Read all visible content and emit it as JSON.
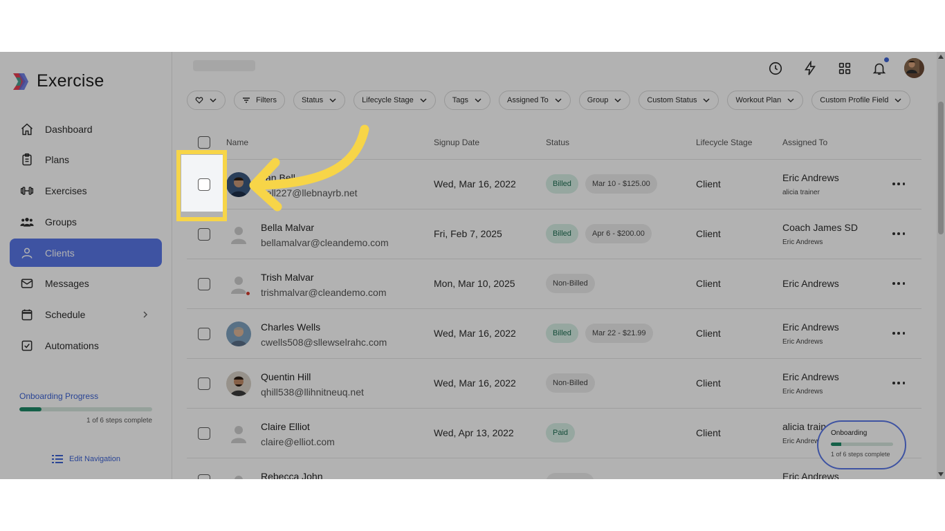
{
  "app": {
    "name": "Exercise"
  },
  "sidebar": {
    "items": [
      {
        "label": "Dashboard",
        "icon": "home-icon"
      },
      {
        "label": "Plans",
        "icon": "clipboard-icon"
      },
      {
        "label": "Exercises",
        "icon": "dumbbell-icon"
      },
      {
        "label": "Groups",
        "icon": "groups-icon"
      },
      {
        "label": "Clients",
        "icon": "user-icon",
        "active": true
      },
      {
        "label": "Messages",
        "icon": "mail-icon"
      },
      {
        "label": "Schedule",
        "icon": "calendar-icon"
      },
      {
        "label": "Automations",
        "icon": "checkbox-icon"
      }
    ],
    "onboarding": {
      "title": "Onboarding Progress",
      "steps_text": "1 of 6 steps complete",
      "progress": 0.167
    },
    "edit_navigation": "Edit Navigation"
  },
  "filters": [
    "Filters",
    "Status",
    "Lifecycle Stage",
    "Tags",
    "Assigned To",
    "Group",
    "Custom Status",
    "Workout Plan",
    "Custom Profile Field"
  ],
  "table": {
    "headers": {
      "name": "Name",
      "signup": "Signup Date",
      "status": "Status",
      "lifecycle": "Lifecycle Stage",
      "assigned": "Assigned To"
    },
    "rows": [
      {
        "name": "Bryan Bell",
        "name_visible": "yan Bell",
        "email_visible": "bell227@llebnayrb.net",
        "date": "Wed, Mar 16, 2022",
        "status": "Billed",
        "amount": "Mar 10 - $125.00",
        "stage": "Client",
        "assigned": "Eric Andrews",
        "assigned2": "alicia trainer"
      },
      {
        "name": "Bella Malvar",
        "email": "bellamalvar@cleandemo.com",
        "date": "Fri, Feb 7, 2025",
        "status": "Billed",
        "amount": "Apr 6 - $200.00",
        "stage": "Client",
        "assigned": "Coach James SD",
        "assigned2": "Eric Andrews"
      },
      {
        "name": "Trish Malvar",
        "email": "trishmalvar@cleandemo.com",
        "date": "Mon, Mar 10, 2025",
        "status": "Non-Billed",
        "stage": "Client",
        "assigned": "Eric Andrews"
      },
      {
        "name": "Charles Wells",
        "email": "cwells508@sllewselrahc.com",
        "date": "Wed, Mar 16, 2022",
        "status": "Billed",
        "amount": "Mar 22 - $21.99",
        "stage": "Client",
        "assigned": "Eric Andrews",
        "assigned2": "Eric Andrews"
      },
      {
        "name": "Quentin Hill",
        "email": "qhill538@llihnitneuq.net",
        "date": "Wed, Mar 16, 2022",
        "status": "Non-Billed",
        "stage": "Client",
        "assigned": "Eric Andrews",
        "assigned2": "Eric Andrews"
      },
      {
        "name": "Claire Elliot",
        "email": "claire@elliot.com",
        "date": "Wed, Apr 13, 2022",
        "status": "Paid",
        "stage": "Client",
        "assigned": "alicia train",
        "assigned2": "Eric Andrew"
      },
      {
        "name": "Rebecca John",
        "assigned": "Eric Andrews"
      }
    ]
  },
  "onboarding_widget": {
    "title": "Onboarding",
    "steps_text": "1 of 6 steps complete",
    "progress": 0.167
  },
  "colors": {
    "accent": "#5a77e8",
    "highlight": "#f7d548",
    "billed_bg": "#d7efe6",
    "billed_text": "#1e6e52",
    "progress": "#1f8a67"
  }
}
